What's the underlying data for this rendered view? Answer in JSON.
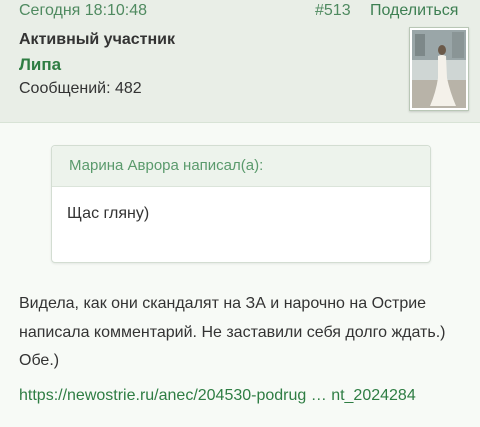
{
  "post": {
    "date": "Сегодня 18:10:48",
    "number": "#513",
    "share_label": "Поделиться"
  },
  "author": {
    "title": "Активный участник",
    "name": "Липа",
    "messages": "Сообщений: 482"
  },
  "quote": {
    "author": "Марина Аврора написал(а):",
    "text": "Щас гляну)"
  },
  "body": {
    "text": "Видела, как они скандалят на ЗА и нарочно на Острие написала комментарий. Не заставили себя долго ждать.) Обе.)",
    "link": "https://newostrie.ru/anec/204530-podrug … nt_2024284"
  },
  "colors": {
    "accent": "#2e7d43",
    "header_bg": "#e9eee7"
  }
}
